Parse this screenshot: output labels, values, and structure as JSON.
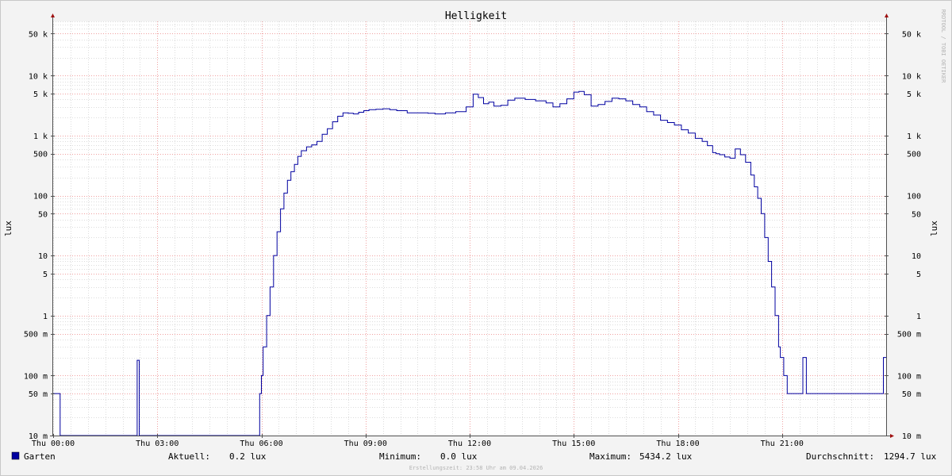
{
  "chart_data": {
    "type": "line",
    "title": "Helligkeit",
    "ylabel": "lux",
    "watermark": "RRDTOOL / TOBI OETIKER",
    "yscale": "log",
    "ylim": [
      0.01,
      80000
    ],
    "xlim_hours": [
      0,
      24
    ],
    "x_tick_labels": [
      "Thu 00:00",
      "Thu 03:00",
      "Thu 06:00",
      "Thu 09:00",
      "Thu 12:00",
      "Thu 15:00",
      "Thu 18:00",
      "Thu 21:00"
    ],
    "x_tick_hours": [
      0,
      3,
      6,
      9,
      12,
      15,
      18,
      21
    ],
    "y_ticks": [
      {
        "value": 0.01,
        "label": "10 m"
      },
      {
        "value": 0.05,
        "label": "50 m"
      },
      {
        "value": 0.1,
        "label": "100 m"
      },
      {
        "value": 0.5,
        "label": "500 m"
      },
      {
        "value": 1,
        "label": "1"
      },
      {
        "value": 5,
        "label": "5"
      },
      {
        "value": 10,
        "label": "10"
      },
      {
        "value": 50,
        "label": "50"
      },
      {
        "value": 100,
        "label": "100"
      },
      {
        "value": 500,
        "label": "500"
      },
      {
        "value": 1000,
        "label": "1 k"
      },
      {
        "value": 5000,
        "label": "5 k"
      },
      {
        "value": 10000,
        "label": "10 k"
      },
      {
        "value": 50000,
        "label": "50 k"
      }
    ],
    "grid": true,
    "series": [
      {
        "name": "Garten",
        "color": "#0000a0",
        "x_hours": [
          0,
          0.15,
          0.18,
          0.2,
          2.4,
          2.42,
          2.44,
          2.48,
          2.5,
          5.9,
          5.95,
          6.0,
          6.05,
          6.15,
          6.25,
          6.35,
          6.45,
          6.55,
          6.65,
          6.75,
          6.85,
          6.95,
          7.05,
          7.15,
          7.3,
          7.45,
          7.6,
          7.75,
          7.9,
          8.05,
          8.2,
          8.35,
          8.5,
          8.65,
          8.8,
          8.95,
          9.1,
          9.3,
          9.5,
          9.7,
          9.9,
          10.2,
          10.5,
          10.8,
          11.0,
          11.3,
          11.6,
          11.9,
          12.1,
          12.25,
          12.4,
          12.55,
          12.7,
          12.9,
          13.1,
          13.3,
          13.6,
          13.9,
          14.2,
          14.4,
          14.6,
          14.8,
          15.0,
          15.15,
          15.3,
          15.5,
          15.7,
          15.9,
          16.1,
          16.3,
          16.5,
          16.7,
          16.9,
          17.1,
          17.3,
          17.5,
          17.7,
          17.9,
          18.1,
          18.3,
          18.5,
          18.7,
          18.85,
          19.0,
          19.1,
          19.2,
          19.35,
          19.5,
          19.65,
          19.8,
          19.95,
          20.1,
          20.2,
          20.3,
          20.4,
          20.5,
          20.6,
          20.7,
          20.8,
          20.9,
          20.95,
          21.05,
          21.15,
          21.3,
          21.45,
          21.55,
          21.6,
          21.62,
          21.7,
          22.0,
          22.5,
          23.0,
          23.5,
          23.9,
          23.92,
          24.0
        ],
        "values": [
          0.05,
          0.05,
          0.05,
          0.01,
          0.01,
          0.18,
          0.18,
          0.01,
          0.01,
          0.01,
          0.05,
          0.1,
          0.3,
          1.0,
          3.0,
          10,
          25,
          60,
          110,
          180,
          250,
          330,
          450,
          560,
          650,
          700,
          800,
          1050,
          1300,
          1700,
          2100,
          2400,
          2350,
          2300,
          2450,
          2600,
          2700,
          2750,
          2800,
          2700,
          2600,
          2400,
          2400,
          2350,
          2300,
          2400,
          2500,
          3000,
          4900,
          4300,
          3400,
          3600,
          3100,
          3200,
          3900,
          4200,
          4000,
          3800,
          3500,
          3000,
          3400,
          4100,
          5300,
          5434.2,
          4800,
          3100,
          3300,
          3700,
          4200,
          4100,
          3800,
          3300,
          3000,
          2500,
          2200,
          1800,
          1650,
          1500,
          1250,
          1100,
          900,
          800,
          680,
          520,
          500,
          480,
          440,
          420,
          600,
          480,
          360,
          220,
          140,
          90,
          50,
          20,
          8,
          3,
          1.0,
          0.3,
          0.2,
          0.1,
          0.05,
          0.05,
          0.05,
          0.05,
          0.2,
          0.2,
          0.05,
          0.05,
          0.05,
          0.05,
          0.05,
          0.05,
          0.2,
          0.2
        ]
      }
    ],
    "legend": {
      "name": "Garten",
      "color": "#0000a0",
      "stats": [
        {
          "label": "Aktuell:",
          "value": "0.2 lux"
        },
        {
          "label": "Minimum:",
          "value": "0.0 lux"
        },
        {
          "label": "Maximum:",
          "value": "5434.2 lux"
        },
        {
          "label": "Durchschnitt:",
          "value": "1294.7 lux"
        }
      ]
    },
    "footer": "Erstellungszeit: 23:58 Uhr am 09.04.2026"
  }
}
